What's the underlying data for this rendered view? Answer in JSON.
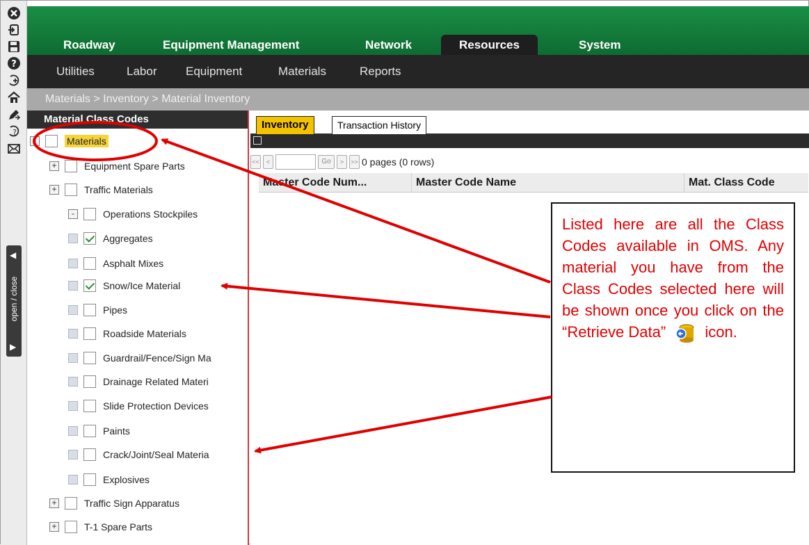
{
  "topnav": {
    "tabs": [
      {
        "label": "Roadway",
        "active": false
      },
      {
        "label": "Equipment Management",
        "active": false
      },
      {
        "label": "Network",
        "active": false
      },
      {
        "label": "Resources",
        "active": true
      },
      {
        "label": "System",
        "active": false
      }
    ]
  },
  "subnav": {
    "items": [
      "Utilities",
      "Labor",
      "Equipment",
      "Materials",
      "Reports"
    ]
  },
  "breadcrumb": "Materials > Inventory > Material Inventory",
  "left_strip": {
    "icons": [
      "close-icon",
      "logout-icon",
      "save-icon",
      "help-icon",
      "add-icon",
      "home-icon",
      "edit-icon",
      "question-icon",
      "mail-icon"
    ],
    "panel_toggle_label": "open / close"
  },
  "tree": {
    "header": "Material Class Codes",
    "nodes": [
      {
        "label": "Materials",
        "toggle": "-",
        "checked": false,
        "level": 0,
        "highlight": true
      },
      {
        "label": "Equipment Spare Parts",
        "toggle": "+",
        "checked": false,
        "level": 1
      },
      {
        "label": "Traffic Materials",
        "toggle": "+",
        "checked": false,
        "level": 1
      },
      {
        "label": "Operations Stockpiles",
        "toggle": "-",
        "checked": false,
        "level": 1
      },
      {
        "label": "Aggregates",
        "toggle": "",
        "checked": true,
        "level": 2
      },
      {
        "label": "Asphalt Mixes",
        "toggle": "",
        "checked": false,
        "level": 2
      },
      {
        "label": "Snow/Ice Material",
        "toggle": "",
        "checked": true,
        "level": 2
      },
      {
        "label": "Pipes",
        "toggle": "",
        "checked": false,
        "level": 2
      },
      {
        "label": "Roadside Materials",
        "toggle": "",
        "checked": false,
        "level": 2
      },
      {
        "label": "Guardrail/Fence/Sign Ma",
        "toggle": "",
        "checked": false,
        "level": 2
      },
      {
        "label": "Drainage Related Materi",
        "toggle": "",
        "checked": false,
        "level": 2
      },
      {
        "label": "Slide Protection Devices",
        "toggle": "",
        "checked": false,
        "level": 2
      },
      {
        "label": "Paints",
        "toggle": "",
        "checked": false,
        "level": 2
      },
      {
        "label": "Crack/Joint/Seal Materia",
        "toggle": "",
        "checked": false,
        "level": 2
      },
      {
        "label": "Explosives",
        "toggle": "",
        "checked": false,
        "level": 2
      },
      {
        "label": "Traffic Sign Apparatus",
        "toggle": "+",
        "checked": false,
        "level": 1
      },
      {
        "label": "T-1 Spare Parts",
        "toggle": "+",
        "checked": false,
        "level": 1
      }
    ]
  },
  "content": {
    "tabs": [
      {
        "label": "Inventory",
        "active": true
      },
      {
        "label": "Transaction History",
        "active": false
      }
    ],
    "pager": {
      "buttons": [
        "<<",
        "<",
        "Go",
        ">",
        ">>"
      ],
      "page_input_value": "",
      "status": "0 pages (0 rows)"
    },
    "columns": [
      "Master Code Num...",
      "Master Code Name",
      "Mat. Class Code"
    ]
  },
  "annotation": {
    "text_before_icon": "Listed here are all the Class Codes available in OMS. Any material you have from the Class Codes selected here will be shown once  you click on the “Retrieve Data”",
    "text_after_icon": "icon.",
    "icon": "retrieve-data-icon"
  },
  "colors": {
    "nav_green": "#16813e",
    "nav_dark": "#252525",
    "active_tab_yellow": "#f4c300",
    "annotation_red": "#e00000"
  }
}
